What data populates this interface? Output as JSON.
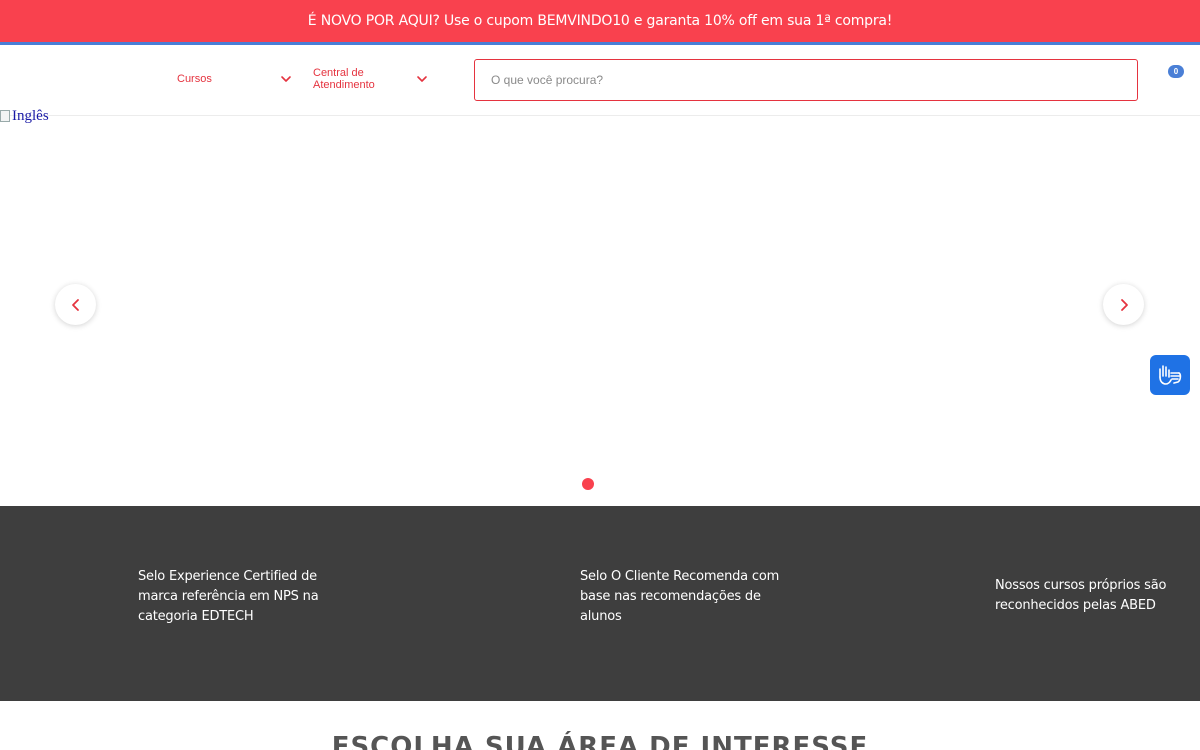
{
  "promo": {
    "text": "É NOVO POR AQUI? Use o cupom BEMVINDO10 e garanta 10% off em sua 1ª compra!"
  },
  "header": {
    "nav": [
      {
        "label": "Cursos"
      },
      {
        "label": "Central de Atendimento"
      }
    ],
    "search_placeholder": "O que você procura?",
    "cart_count": "0"
  },
  "banner": {
    "image_alt": "Inglês",
    "slide_count": 1,
    "active_slide": 1
  },
  "seals": [
    {
      "text": "Selo Experience Certified de marca referência em NPS na categoria EDTECH"
    },
    {
      "text": "Selo O Cliente Recomenda com base nas recomendações de alunos"
    },
    {
      "text": "Nossos cursos próprios são reconhecidos pelas ABED"
    }
  ],
  "section": {
    "title": "ESCOLHA SUA ÁREA DE INTERESSE"
  },
  "icons": {
    "nav_chevron": "chevron-down-icon",
    "prev": "chevron-left-icon",
    "next": "chevron-right-icon",
    "accessibility": "sign-language-hands-icon",
    "broken_image": "broken-image-icon"
  },
  "colors": {
    "brand_red": "#f9414e",
    "link_red": "#e5333f",
    "accent_blue": "#4a7fd6",
    "accessibility_blue": "#1f72e5",
    "seals_bg": "#3e3e3e"
  }
}
